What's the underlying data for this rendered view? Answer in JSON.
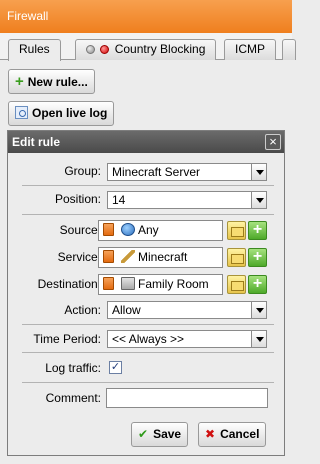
{
  "window": {
    "title": "Firewall"
  },
  "tabs": [
    {
      "label": "Rules"
    },
    {
      "label": "Country Blocking"
    },
    {
      "label": "ICMP"
    }
  ],
  "toolbar": {
    "new_rule_label": "New rule...",
    "open_live_log_label": "Open live log"
  },
  "dialog": {
    "title": "Edit rule",
    "close_glyph": "×",
    "fields": {
      "group": {
        "label": "Group:",
        "value": "Minecraft Server"
      },
      "position": {
        "label": "Position:",
        "value": "14"
      },
      "source": {
        "label": "Source:",
        "value": "Any",
        "icon": "globe-icon"
      },
      "service": {
        "label": "Service:",
        "value": "Minecraft",
        "icon": "service-icon"
      },
      "destination": {
        "label": "Destination:",
        "value": "Family Room",
        "icon": "computer-icon"
      },
      "action": {
        "label": "Action:",
        "value": "Allow"
      },
      "time_period": {
        "label": "Time Period:",
        "value": "<< Always >>"
      },
      "log_traffic": {
        "label": "Log traffic:",
        "checked": true,
        "check_glyph": "✓"
      },
      "comment": {
        "label": "Comment:",
        "value": ""
      }
    },
    "buttons": {
      "save": "Save",
      "cancel": "Cancel"
    }
  },
  "colors": {
    "title_bar": "#ef7f1e",
    "dialog_title": "#4a4a4a",
    "add_green": "#4ea92a"
  }
}
